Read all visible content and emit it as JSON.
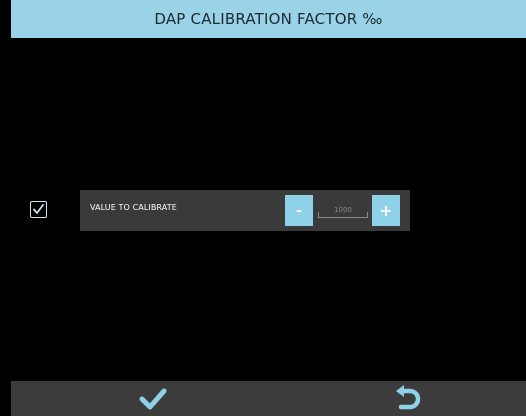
{
  "header": {
    "title": "DAP CALIBRATION FACTOR ‰"
  },
  "calibration": {
    "checked": true,
    "label": "VALUE TO CALIBRATE",
    "minus_label": "-",
    "plus_label": "+",
    "value": "1000"
  },
  "footer": {
    "confirm_icon": "checkmark-icon",
    "back_icon": "undo-arrow-icon"
  },
  "colors": {
    "accent": "#8ed1e8",
    "header_bg": "#9ad3e7",
    "panel_bg": "#3a3a3a",
    "footer_bg": "#3c3c3c",
    "background": "#000000"
  }
}
